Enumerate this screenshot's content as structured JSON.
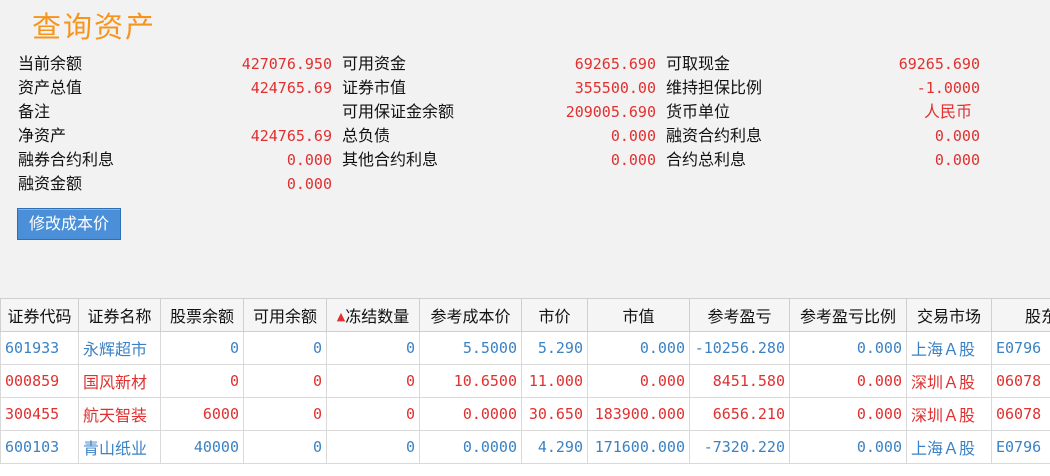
{
  "title": "查询资产",
  "summary": [
    [
      {
        "label": "当前余额",
        "value": "427076.950"
      },
      {
        "label": "可用资金",
        "value": "69265.690"
      },
      {
        "label": "可取现金",
        "value": "69265.690"
      }
    ],
    [
      {
        "label": "资产总值",
        "value": "424765.69"
      },
      {
        "label": "证券市值",
        "value": "355500.00"
      },
      {
        "label": "维持担保比例",
        "value": "-1.0000"
      }
    ],
    [
      {
        "label": "备注",
        "value": ""
      },
      {
        "label": "可用保证金余额",
        "value": "209005.690"
      },
      {
        "label": "货币单位",
        "value": "人民币"
      }
    ],
    [
      {
        "label": "净资产",
        "value": "424765.69"
      },
      {
        "label": "总负债",
        "value": "0.000"
      },
      {
        "label": "融资合约利息",
        "value": "0.000"
      }
    ],
    [
      {
        "label": "融券合约利息",
        "value": "0.000"
      },
      {
        "label": "其他合约利息",
        "value": "0.000"
      },
      {
        "label": "合约总利息",
        "value": "0.000"
      }
    ],
    [
      {
        "label": "融资金额",
        "value": "0.000"
      }
    ]
  ],
  "button_label": "修改成本价",
  "table": {
    "sort_arrow": "▲",
    "columns": [
      "证券代码",
      "证券名称",
      "股票余额",
      "可用余额",
      "冻结数量",
      "参考成本价",
      "市价",
      "市值",
      "参考盈亏",
      "参考盈亏比例",
      "交易市场",
      "股东"
    ],
    "rows": [
      {
        "color": "blue",
        "cells": [
          "601933",
          "永辉超市",
          "0",
          "0",
          "0",
          "5.5000",
          "5.290",
          "0.000",
          "-10256.280",
          "0.000",
          "上海Ａ股",
          "E0796"
        ]
      },
      {
        "color": "red",
        "cells": [
          "000859",
          "国风新材",
          "0",
          "0",
          "0",
          "10.6500",
          "11.000",
          "0.000",
          "8451.580",
          "0.000",
          "深圳Ａ股",
          "06078"
        ]
      },
      {
        "color": "red",
        "cells": [
          "300455",
          "航天智装",
          "6000",
          "0",
          "0",
          "0.0000",
          "30.650",
          "183900.000",
          "6656.210",
          "0.000",
          "深圳Ａ股",
          "06078"
        ]
      },
      {
        "color": "blue",
        "cells": [
          "600103",
          "青山纸业",
          "40000",
          "0",
          "0",
          "0.0000",
          "4.290",
          "171600.000",
          "-7320.220",
          "0.000",
          "上海Ａ股",
          "E0796"
        ]
      }
    ]
  }
}
